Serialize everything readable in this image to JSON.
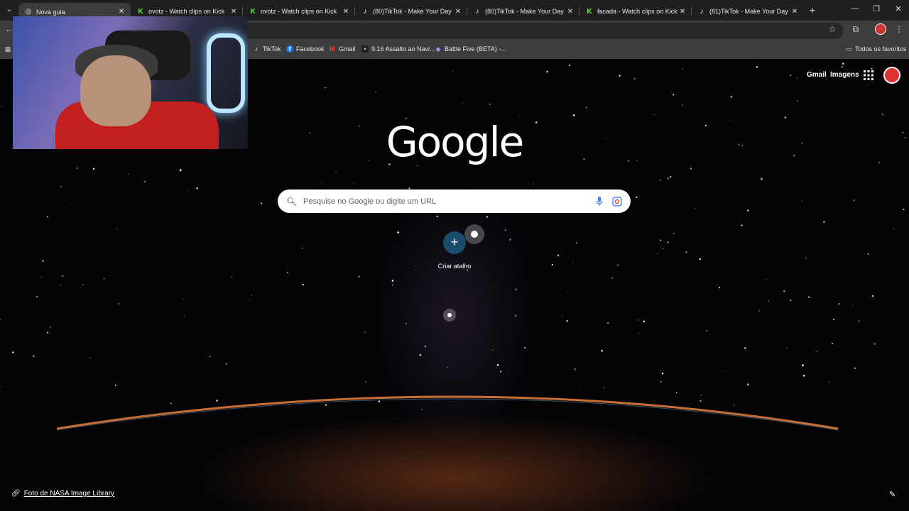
{
  "browser": {
    "tabs": [
      {
        "title": "Nova guia",
        "active": true,
        "favicon": "chrome-icon"
      },
      {
        "title": "ovotz - Watch clips on Kick",
        "active": false,
        "favicon": "kick-icon"
      },
      {
        "title": "ovotz - Watch clips on Kick",
        "active": false,
        "favicon": "kick-icon"
      },
      {
        "title": "(80)TikTok - Make Your Day",
        "active": false,
        "favicon": "tiktok-icon"
      },
      {
        "title": "(80)TikTok - Make Your Day",
        "active": false,
        "favicon": "tiktok-icon"
      },
      {
        "title": "facada - Watch clips on Kick",
        "active": false,
        "favicon": "kick-icon"
      },
      {
        "title": "(81)TikTok - Make Your Day",
        "active": false,
        "favicon": "tiktok-icon"
      }
    ],
    "bookmarks": [
      {
        "label": "TikTok",
        "icon": "tiktok-icon"
      },
      {
        "label": "Facebook",
        "icon": "facebook-icon"
      },
      {
        "label": "Gmail",
        "icon": "gmail-icon"
      },
      {
        "label": "9.16 Assalto ao Navi...",
        "icon": "bookmark-icon"
      },
      {
        "label": "Battle Five (BETA) -...",
        "icon": "bookmark-icon"
      }
    ],
    "all_bookmarks_label": "Todos os favoritos"
  },
  "newtab": {
    "gmail_label": "Gmail",
    "images_label": "Imagens",
    "logo_text": "Google",
    "search_placeholder": "Pesquise no Google ou digite um URL",
    "shortcut_label": "Criar atalho",
    "photo_credit": "Foto de NASA Image Library"
  },
  "colors": {
    "titlebar": "#1f1f1f",
    "toolbar": "#3c3c3c",
    "kick_green": "#53fc18",
    "shortcut_bg": "#194d6a"
  }
}
